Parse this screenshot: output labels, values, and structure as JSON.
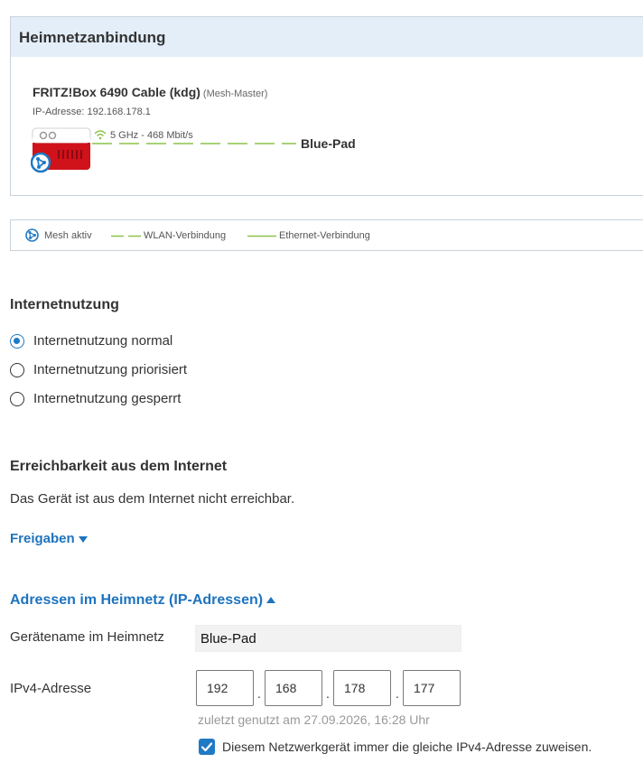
{
  "heimnetz": {
    "title": "Heimnetzanbindung",
    "device_name": "FRITZ!Box 6490 Cable (kdg)",
    "device_role": "(Mesh-Master)",
    "ip_line": "IP-Adresse: 192.168.178.1",
    "connection_label": "5 GHz  - 468 Mbit/s",
    "client_name": "Blue-Pad"
  },
  "legend": {
    "mesh": "Mesh aktiv",
    "wlan": "WLAN-Verbindung",
    "ethernet": "Ethernet-Verbindung"
  },
  "internet": {
    "title": "Internetnutzung",
    "options": [
      {
        "label": "Internetnutzung normal",
        "selected": true
      },
      {
        "label": "Internetnutzung priorisiert",
        "selected": false
      },
      {
        "label": "Internetnutzung gesperrt",
        "selected": false
      }
    ]
  },
  "reach": {
    "title": "Erreichbarkeit aus dem Internet",
    "text": "Das Gerät ist aus dem Internet nicht erreichbar.",
    "freigaben": "Freigaben"
  },
  "addresses": {
    "title": "Adressen im Heimnetz (IP-Adressen)",
    "name_label": "Gerätename im Heimnetz",
    "name_value": "Blue-Pad",
    "ipv4_label": "IPv4-Adresse",
    "ip_octets": [
      "192",
      "168",
      "178",
      "177"
    ],
    "ip_dot": ".",
    "last_used": "zuletzt genutzt am 27.09.2026, 16:28 Uhr",
    "same_ip_label": "Diesem Netzwerkgerät immer die gleiche IPv4-Adresse zuweisen.",
    "same_ip_checked": true
  },
  "colors": {
    "accent": "#1f7ac4",
    "link": "#1e73be",
    "router_red": "#d0121b",
    "wlan_green": "#8bc34a",
    "header_bg": "#e3eef9"
  }
}
